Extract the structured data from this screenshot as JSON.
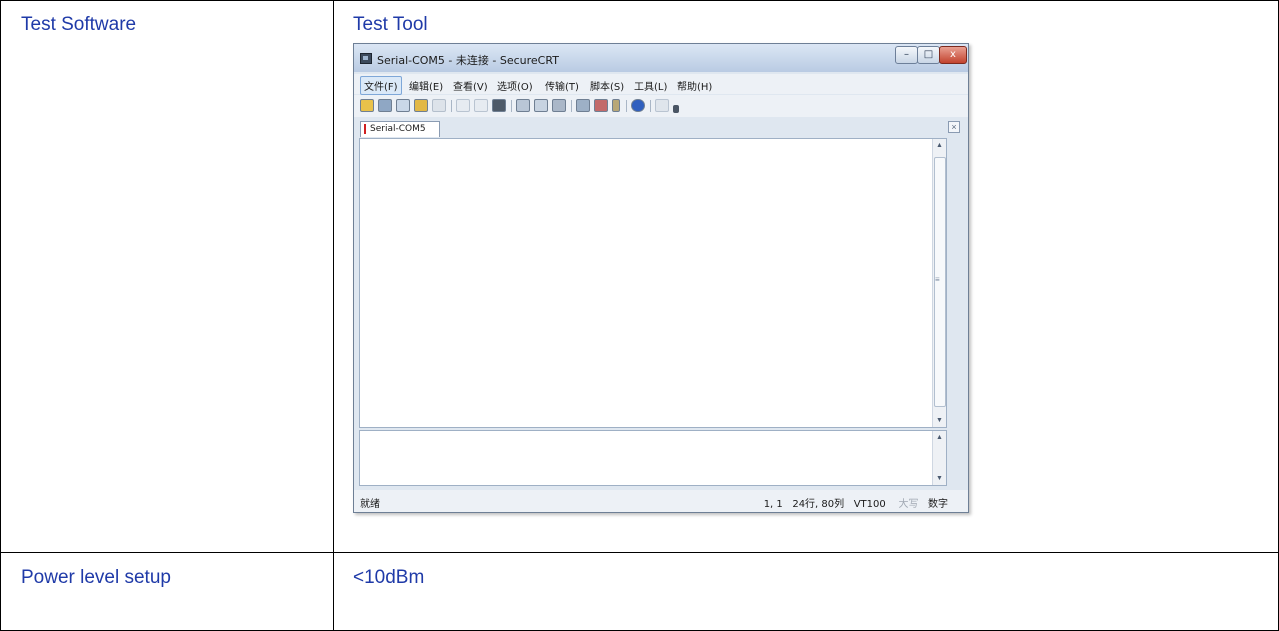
{
  "table": {
    "row1_label": "Test Software",
    "row1_value_title": "Test Tool",
    "row2_label": "Power level setup",
    "row2_value": "<10dBm"
  },
  "window": {
    "title": "Serial-COM5 - 未连接 - SecureCRT",
    "controls": {
      "minimize": "–",
      "maximize": "□",
      "close": "x"
    }
  },
  "menu": [
    "文件(F)",
    "编辑(E)",
    "查看(V)",
    "选项(O)",
    "传输(T)",
    "脚本(S)",
    "工具(L)",
    "帮助(H)"
  ],
  "tab": {
    "label": "Serial-COM5",
    "close": "×"
  },
  "status": {
    "ready": "就绪",
    "position": "1,  1",
    "size": "24行, 80列",
    "emulation": "VT100",
    "caps": "大写",
    "num": "数字"
  },
  "colors": {
    "table_text": "#1f3aa8",
    "close_button": "#c2432e"
  }
}
